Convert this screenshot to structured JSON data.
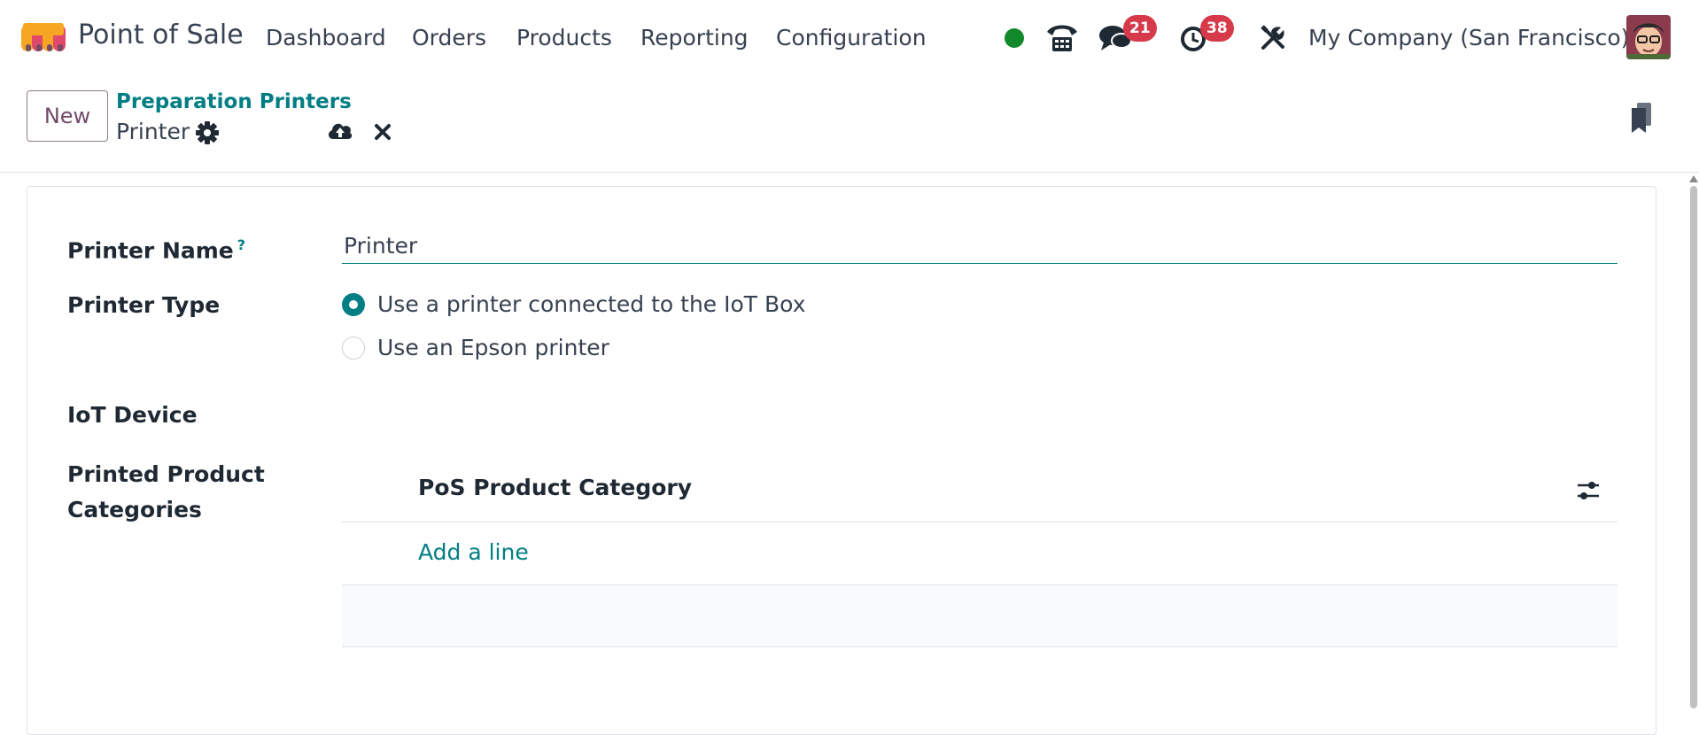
{
  "navbar": {
    "app_title": "Point of Sale",
    "menu": [
      "Dashboard",
      "Orders",
      "Products",
      "Reporting",
      "Configuration"
    ],
    "status_color": "#14892c",
    "messages_badge": "21",
    "activities_badge": "38",
    "company": "My Company (San Francisco)"
  },
  "control_panel": {
    "new_label": "New",
    "breadcrumb_parent": "Preparation Printers",
    "record_name": "Printer"
  },
  "form": {
    "printer_name_label": "Printer Name",
    "tooltip_mark": "?",
    "printer_name_value": "Printer",
    "printer_type_label": "Printer Type",
    "printer_type_options": [
      "Use a printer connected to the IoT Box",
      "Use an Epson printer"
    ],
    "printer_type_selected": "Use a printer connected to the IoT Box",
    "iot_device_label": "IoT Device",
    "categories_label_line1": "Printed Product",
    "categories_label_line2": "Categories",
    "categories_column": "PoS Product Category",
    "add_line_label": "Add a line"
  },
  "colors": {
    "brand": "#714b67",
    "accent": "#017e84",
    "badge": "#d63a4a"
  }
}
